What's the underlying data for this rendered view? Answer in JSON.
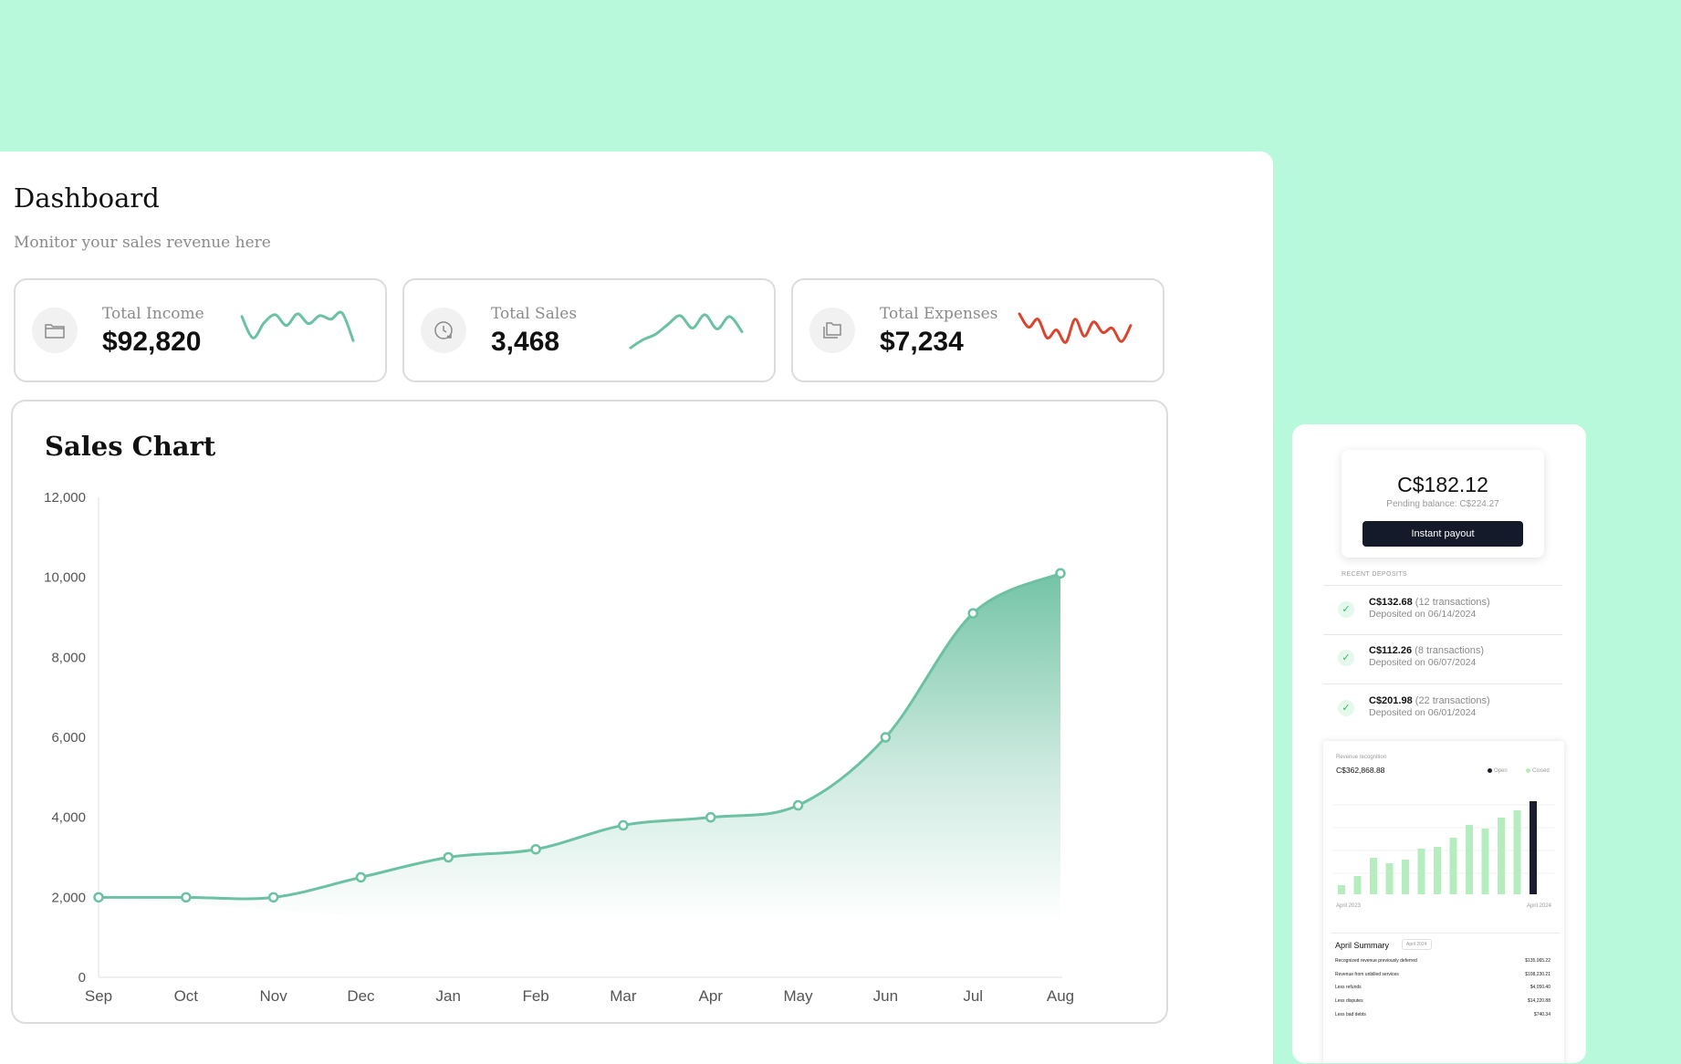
{
  "dashboard": {
    "title": "Dashboard",
    "subtitle": "Monitor your sales revenue here",
    "kpis": [
      {
        "label": "Total Income",
        "value": "$92,820",
        "icon": "folder-icon",
        "spark_color": "#6cc1a2",
        "trend": [
          3.9,
          1.5,
          3.2,
          4.1,
          2.9,
          4.2,
          3.1,
          4.0,
          3.6,
          4.3,
          1.2
        ]
      },
      {
        "label": "Total Sales",
        "value": "3,468",
        "icon": "clock-refresh-icon",
        "spark_color": "#6cc1a2",
        "trend": [
          0.4,
          1.3,
          1.9,
          3.0,
          4.0,
          2.6,
          4.1,
          2.5,
          3.9,
          2.2
        ]
      },
      {
        "label": "Total Expenses",
        "value": "$7,234",
        "icon": "files-icon",
        "spark_color": "#d9452e",
        "trend": [
          4.2,
          2.7,
          3.6,
          1.5,
          2.4,
          1.0,
          3.6,
          1.7,
          3.3,
          2.1,
          2.6,
          1.1,
          2.9
        ]
      }
    ]
  },
  "sales_chart": {
    "title": "Sales Chart"
  },
  "chart_data": {
    "type": "area",
    "title": "Sales Chart",
    "categories": [
      "Sep",
      "Oct",
      "Nov",
      "Dec",
      "Jan",
      "Feb",
      "Mar",
      "Apr",
      "May",
      "Jun",
      "Jul",
      "Aug"
    ],
    "values": [
      2000,
      2000,
      2000,
      2500,
      3000,
      3200,
      3800,
      4000,
      4300,
      6000,
      9100,
      10100
    ],
    "ylim": [
      0,
      12000
    ],
    "yticks": [
      "0",
      "2,000",
      "4,000",
      "6,000",
      "8,000",
      "10,000",
      "12,000"
    ],
    "grid": false,
    "color": "#6cc1a2"
  },
  "payout_panel": {
    "balance": "C$182.12",
    "pending": "Pending balance: C$224.27",
    "button": "Instant payout",
    "recent_title": "RECENT DEPOSITS",
    "deposits": [
      {
        "amount": "C$132.68",
        "tx": "(12 transactions)",
        "date": "Deposited on 06/14/2024"
      },
      {
        "amount": "C$112.26",
        "tx": "(8 transactions)",
        "date": "Deposited on 06/07/2024"
      },
      {
        "amount": "C$201.98",
        "tx": "(22 transactions)",
        "date": "Deposited on 06/01/2024"
      }
    ],
    "revenue": {
      "title": "Revenue recognition",
      "amount": "C$362,868.88",
      "legend_open": "Open",
      "legend_closed": "Closed",
      "x_start": "April 2023",
      "x_end": "April 2024",
      "bars": [
        1,
        2,
        4,
        3.4,
        3.8,
        5,
        5.2,
        6.2,
        7.6,
        7.2,
        8.4,
        9.2,
        10.2
      ],
      "colors": {
        "closed": "#b5edbf",
        "open": "#1b1d2e"
      }
    },
    "summary": {
      "title": "April Summary",
      "tag": "April 2024",
      "rows": [
        {
          "label": "Recognized revenue previously deferred",
          "value": "$135,065.22"
        },
        {
          "label": "Revenue from unbilled services",
          "value": "$108,230.21"
        },
        {
          "label": "Less refunds",
          "value": "$4,050.40"
        },
        {
          "label": "Less disputes",
          "value": "$14,220.88"
        },
        {
          "label": "Less bad debts",
          "value": "$740.34"
        }
      ]
    }
  }
}
